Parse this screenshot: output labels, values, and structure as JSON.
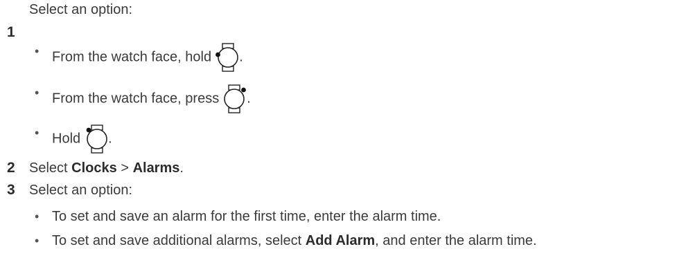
{
  "steps": [
    {
      "number": "1",
      "text": "Select an option:",
      "options": [
        {
          "prefix": "From the watch face, hold",
          "suffix": ".",
          "button_icon": "watch-button-left-icon"
        },
        {
          "prefix": "From the watch face, press",
          "suffix": ".",
          "button_icon": "watch-button-upper-right-icon"
        },
        {
          "prefix": "Hold",
          "suffix": ".",
          "button_icon": "watch-button-upper-left-icon"
        }
      ]
    },
    {
      "number": "2",
      "text_before": "Select",
      "bold1": "Clocks",
      "separator": ">",
      "bold2": "Alarms",
      "text_after": "."
    },
    {
      "number": "3",
      "text": "Select an option:",
      "options": [
        {
          "text": "To set and save an alarm for the first time, enter the alarm time."
        },
        {
          "text_before": "To set and save additional alarms, select",
          "bold": "Add Alarm",
          "text_after": ", and enter the alarm time."
        }
      ]
    }
  ],
  "bullet_char": "•"
}
